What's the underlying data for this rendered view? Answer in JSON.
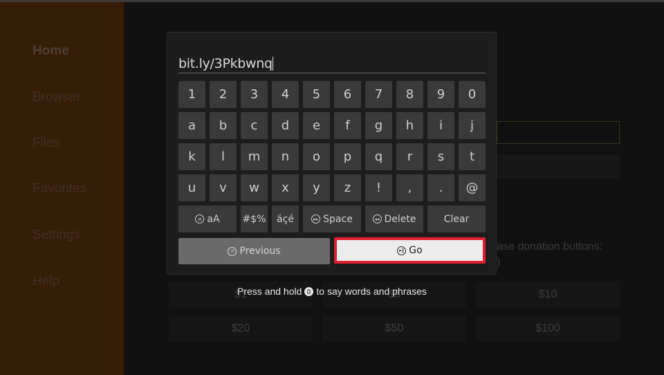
{
  "sidebar": {
    "items": [
      {
        "label": "Home",
        "active": true
      },
      {
        "label": "Browser"
      },
      {
        "label": "Files"
      },
      {
        "label": "Favorites"
      },
      {
        "label": "Settings"
      },
      {
        "label": "Help"
      }
    ]
  },
  "background": {
    "donation_text": "ase donation buttons:",
    "donation_text2": ")",
    "donations": [
      "$1",
      "$5",
      "$10",
      "$20",
      "$50",
      "$100"
    ]
  },
  "keyboard": {
    "input_value": "bit.ly/3Pkbwnq",
    "rows": [
      [
        "1",
        "2",
        "3",
        "4",
        "5",
        "6",
        "7",
        "8",
        "9",
        "0"
      ],
      [
        "a",
        "b",
        "c",
        "d",
        "e",
        "f",
        "g",
        "h",
        "i",
        "j"
      ],
      [
        "k",
        "l",
        "m",
        "n",
        "o",
        "p",
        "q",
        "r",
        "s",
        "t"
      ],
      [
        "u",
        "v",
        "w",
        "x",
        "y",
        "z",
        "!",
        ",",
        ".",
        "@"
      ]
    ],
    "case_label": "aA",
    "symbols_label": "#$%",
    "accents_label": "äçé",
    "space_label": "Space",
    "delete_label": "Delete",
    "clear_label": "Clear",
    "previous_label": "Previous",
    "go_label": "Go",
    "highlight_color": "#e02030"
  },
  "hint": {
    "before": "Press and hold",
    "after": "to say words and phrases"
  }
}
